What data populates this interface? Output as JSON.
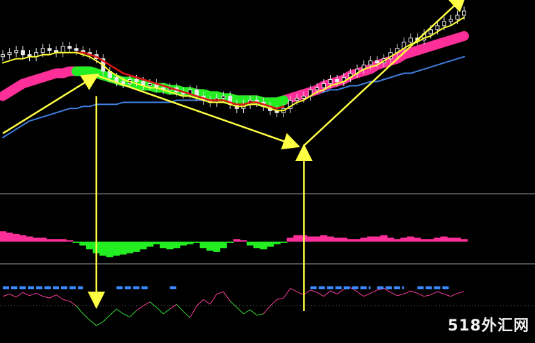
{
  "watermark": "518外汇网",
  "colors": {
    "background": "#000000",
    "candle": "#e8e8e8",
    "ma_yellow": "#ffff33",
    "ma_pink": "#ff2f9a",
    "ma_blue": "#3f7fe0",
    "ma_red": "#e01515",
    "trend_green": "#22ee22",
    "hist_pos": "#ff2f9a",
    "hist_neg": "#22ee22",
    "arrow": "#ffff44",
    "divider": "#9a9a9a",
    "signal_blue": "#3a8bff",
    "osc_pink": "#ff3fa0",
    "osc_green": "#33dd33",
    "zero_line": "#777777"
  },
  "chart_data": [
    {
      "type": "candlestick",
      "panel": "price",
      "title": "",
      "close": [
        120,
        121,
        122,
        120,
        119,
        121,
        123,
        122,
        121,
        124,
        123,
        122,
        121,
        120,
        118,
        112,
        109,
        107,
        106,
        108,
        107,
        105,
        106,
        104,
        103,
        104,
        102,
        101,
        103,
        100,
        98,
        97,
        99,
        100,
        96,
        94,
        96,
        98,
        97,
        95,
        93,
        92,
        94,
        98,
        99,
        100,
        103,
        104,
        106,
        108,
        107,
        109,
        111,
        113,
        115,
        117,
        116,
        118,
        121,
        123,
        126,
        128,
        127,
        130,
        132,
        134,
        136,
        137,
        139,
        141
      ],
      "series": [
        {
          "name": "",
          "role": "yellow-ma",
          "values": [
            116,
            117,
            118,
            118,
            119,
            119,
            120,
            120,
            121,
            121,
            121,
            121,
            120,
            119,
            117,
            115,
            112,
            110,
            108,
            107,
            106,
            105,
            104,
            104,
            103,
            102,
            101,
            100,
            100,
            99,
            98,
            97,
            97,
            97,
            96,
            95,
            95,
            96,
            96,
            95,
            94,
            93,
            93,
            95,
            97,
            98,
            100,
            102,
            103,
            105,
            106,
            107,
            109,
            111,
            113,
            114,
            115,
            117,
            119,
            121,
            123,
            125,
            126,
            128,
            129,
            131,
            133,
            134,
            136,
            138
          ]
        },
        {
          "name": "",
          "role": "pink-ma",
          "values": [
            100,
            102,
            104,
            106,
            107,
            108,
            109,
            110,
            111,
            111,
            112,
            112,
            112,
            112,
            111,
            110,
            109,
            108,
            107,
            107,
            106,
            105,
            105,
            104,
            104,
            103,
            103,
            102,
            102,
            101,
            101,
            100,
            100,
            99,
            99,
            98,
            98,
            98,
            98,
            97,
            97,
            97,
            98,
            99,
            100,
            101,
            102,
            103,
            105,
            106,
            107,
            108,
            110,
            111,
            112,
            113,
            115,
            116,
            117,
            118,
            120,
            121,
            122,
            123,
            124,
            125,
            126,
            127,
            128,
            129
          ]
        },
        {
          "name": "",
          "role": "blue-ma",
          "values": [
            80,
            82,
            84,
            86,
            88,
            89,
            90,
            91,
            92,
            93,
            94,
            94,
            95,
            95,
            96,
            96,
            96,
            96,
            97,
            97,
            97,
            97,
            97,
            97,
            97,
            97,
            98,
            98,
            98,
            98,
            98,
            98,
            98,
            98,
            98,
            98,
            98,
            98,
            98,
            98,
            98,
            98,
            99,
            99,
            100,
            100,
            101,
            101,
            102,
            103,
            103,
            104,
            105,
            105,
            106,
            107,
            107,
            108,
            109,
            110,
            111,
            111,
            112,
            113,
            114,
            115,
            116,
            117,
            118,
            119
          ]
        },
        {
          "name": "",
          "role": "red-ma",
          "values": [
            null,
            null,
            null,
            null,
            null,
            null,
            null,
            null,
            null,
            null,
            null,
            121,
            121,
            120,
            119,
            117,
            115,
            113,
            111,
            110,
            109,
            108,
            107,
            106,
            105,
            104,
            103,
            102,
            101,
            100,
            99,
            98,
            98,
            98,
            97,
            96,
            96,
            97,
            97,
            96,
            95,
            94,
            95,
            null,
            null,
            null,
            null,
            null,
            null,
            null,
            null,
            null,
            null,
            null,
            null,
            null,
            null,
            null,
            null,
            null,
            null,
            null,
            null,
            null,
            null,
            null,
            null,
            null,
            null,
            null
          ]
        }
      ],
      "arrows": [
        {
          "from": [
            0,
            82
          ],
          "to": [
            14,
            110
          ]
        },
        {
          "from": [
            14,
            110
          ],
          "to": [
            44,
            76
          ]
        },
        {
          "from": [
            45,
            76
          ],
          "to": [
            69,
            148
          ]
        }
      ]
    },
    {
      "type": "area",
      "panel": "histogram",
      "title": "",
      "values": [
        8,
        7,
        6,
        5,
        4,
        3,
        3,
        2,
        2,
        2,
        1,
        -1,
        -3,
        -6,
        -9,
        -11,
        -12,
        -11,
        -10,
        -9,
        -8,
        -6,
        -4,
        -2,
        -5,
        -6,
        -5,
        -3,
        -2,
        -1,
        -5,
        -7,
        -8,
        -5,
        -1,
        2,
        1,
        -3,
        -5,
        -6,
        -4,
        -2,
        -1,
        3,
        5,
        5,
        4,
        4,
        5,
        4,
        3,
        3,
        2,
        2,
        3,
        4,
        4,
        5,
        3,
        2,
        3,
        4,
        3,
        2,
        2,
        3,
        4,
        3,
        3,
        2
      ],
      "ylim": [
        -14,
        14
      ]
    },
    {
      "type": "line",
      "panel": "oscillator",
      "title": "",
      "series": [
        {
          "name": "",
          "role": "oscillator",
          "values": [
            52,
            55,
            51,
            57,
            53,
            56,
            52,
            50,
            54,
            48,
            46,
            40,
            30,
            22,
            15,
            20,
            28,
            36,
            30,
            26,
            34,
            40,
            45,
            38,
            30,
            36,
            42,
            33,
            25,
            40,
            48,
            42,
            55,
            58,
            46,
            38,
            30,
            35,
            28,
            30,
            40,
            48,
            50,
            62,
            58,
            54,
            60,
            57,
            52,
            59,
            55,
            61,
            63,
            58,
            52,
            56,
            60,
            62,
            57,
            53,
            55,
            59,
            56,
            52,
            54,
            58,
            55,
            52,
            56,
            58
          ]
        }
      ],
      "signal_segments": [
        [
          0,
          12
        ],
        [
          17,
          22
        ],
        [
          25,
          26
        ],
        [
          46,
          55
        ],
        [
          56,
          60
        ],
        [
          62,
          67
        ]
      ],
      "ylim": [
        0,
        80
      ]
    }
  ]
}
